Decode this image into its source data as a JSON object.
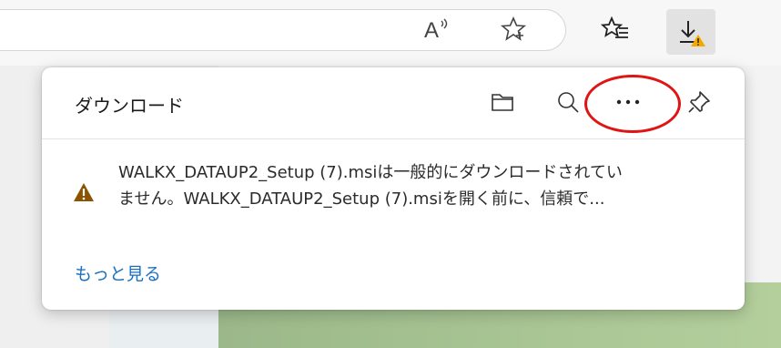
{
  "toolbar": {
    "icons": [
      "read-aloud-icon",
      "favorite-star-icon",
      "favorites-list-icon",
      "downloads-icon"
    ],
    "read_aloud_glyph": "A"
  },
  "downloads_panel": {
    "title": "ダウンロード",
    "actions": [
      "open-folder-icon",
      "search-icon",
      "more-options-icon",
      "pin-icon"
    ],
    "more_glyph": "···",
    "items": [
      {
        "status_icon": "warning-icon",
        "status_color": "#8a5300",
        "line1": "WALKX_DATAUP2_Setup (7).msiは一般的にダウンロードされてい",
        "line2": "ません。WALKX_DATAUP2_Setup (7).msiを開く前に、信頼で..."
      }
    ],
    "more_link": "もっと見る"
  },
  "annotation": {
    "highlight_color": "#e01414"
  },
  "colors": {
    "link": "#1a6fc0",
    "warning_badge": "#f2a900"
  }
}
